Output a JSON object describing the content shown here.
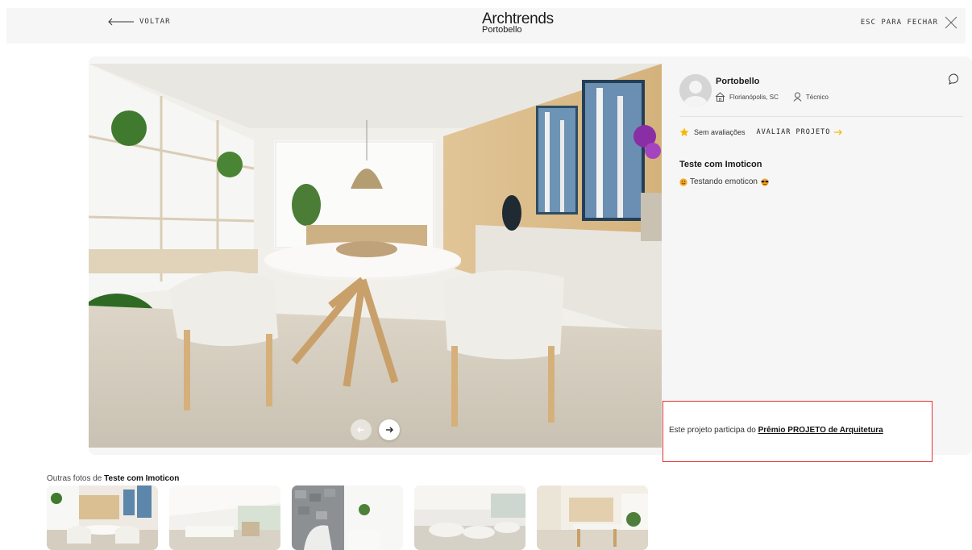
{
  "header": {
    "back_label": "VOLTAR",
    "brand_name": "Archtrends",
    "brand_sub": "Portobello",
    "close_label": "ESC PARA FECHAR"
  },
  "author": {
    "name": "Portobello",
    "location": "Florianópolis, SC",
    "role": "Técnico"
  },
  "rating": {
    "text": "Sem avaliações",
    "action": "AVALIAR PROJETO"
  },
  "project": {
    "title": "Teste com Imoticon",
    "description": "Testando emoticon"
  },
  "award": {
    "prefix": "Este projeto participa do ",
    "link": "Prêmio PROJETO de Arquitetura"
  },
  "gallery": {
    "prefix": "Outras fotos de ",
    "title": "Teste com Imoticon",
    "thumbs": [
      "dining",
      "living-open",
      "stone-wall",
      "lounge",
      "kitchen"
    ]
  },
  "colors": {
    "accent": "#f5b800",
    "highlight_border": "#e0322f",
    "panel_bg": "#f6f6f6"
  }
}
